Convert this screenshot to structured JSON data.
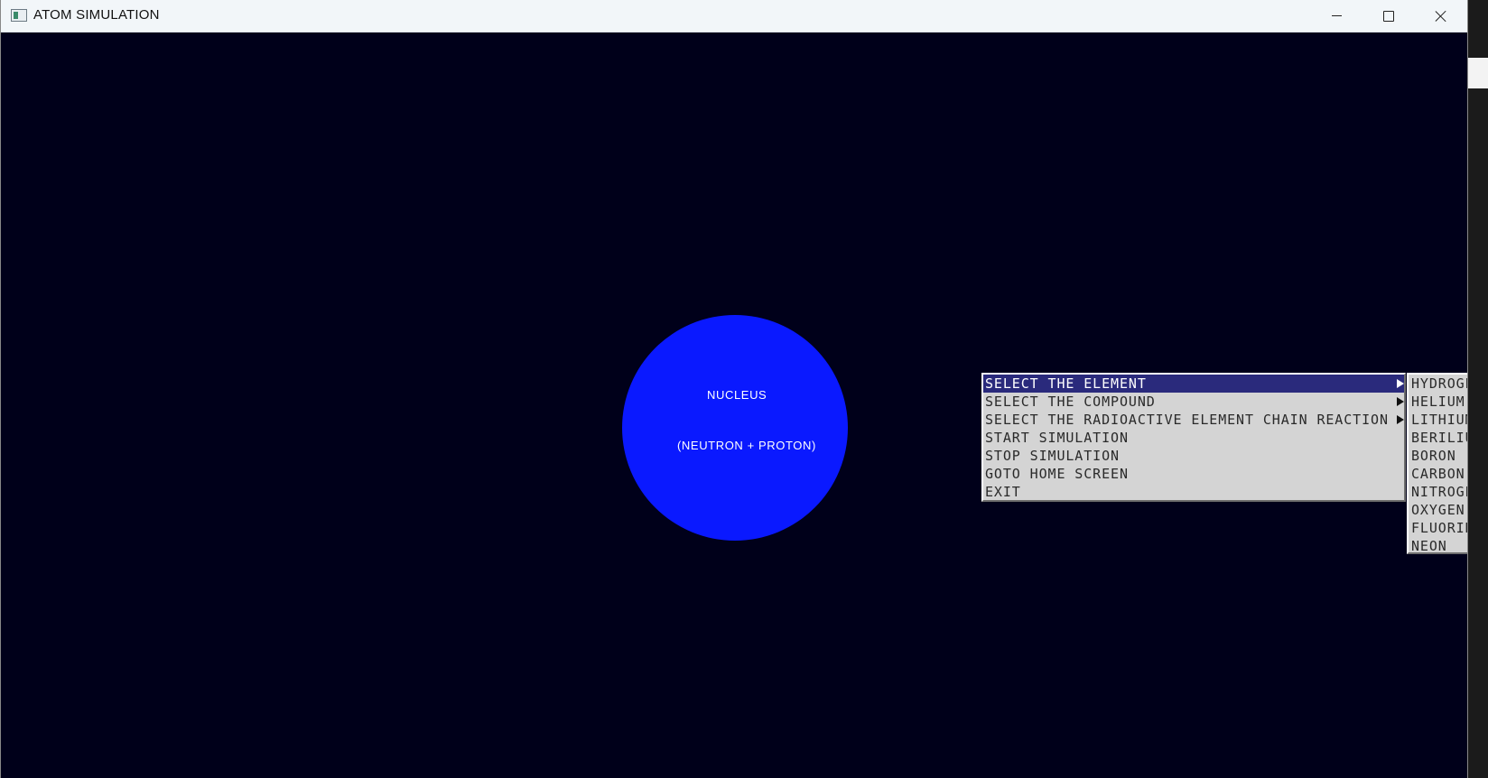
{
  "window": {
    "title": "ATOM SIMULATION",
    "background_color": "#00001a"
  },
  "titlebar_buttons": {
    "minimize_icon": "minimize-icon",
    "maximize_icon": "maximize-icon",
    "close_icon": "close-icon"
  },
  "nucleus": {
    "label": "NUCLEUS",
    "sublabel": "(NEUTRON + PROTON)",
    "color": "#0a19ff"
  },
  "main_menu": {
    "highlight_color": "#2a2a7c",
    "items": [
      {
        "label": "SELECT THE ELEMENT",
        "has_submenu": true,
        "highlighted": true
      },
      {
        "label": "SELECT THE COMPOUND",
        "has_submenu": true,
        "highlighted": false
      },
      {
        "label": "SELECT THE RADIOACTIVE ELEMENT CHAIN REACTION",
        "has_submenu": true,
        "highlighted": false
      },
      {
        "label": "START SIMULATION",
        "has_submenu": false,
        "highlighted": false
      },
      {
        "label": "STOP SIMULATION",
        "has_submenu": false,
        "highlighted": false
      },
      {
        "label": "GOTO HOME SCREEN",
        "has_submenu": false,
        "highlighted": false
      },
      {
        "label": "EXIT",
        "has_submenu": false,
        "highlighted": false
      }
    ]
  },
  "element_submenu": {
    "items": [
      "HYDROGEN",
      "HELIUM",
      "LITHIUM",
      "BERILIUM",
      "BORON",
      "CARBON",
      "NITROGEN",
      "OXYGEN",
      "FLUORINE",
      "NEON"
    ]
  }
}
